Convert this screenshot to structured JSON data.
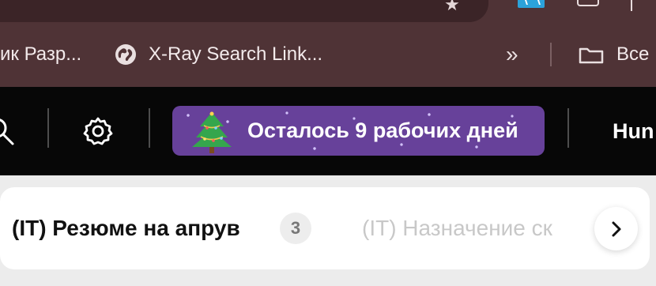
{
  "browser": {
    "bookmarks": [
      {
        "label": "ик Разр..."
      },
      {
        "label": "X-Ray Search Link..."
      },
      {
        "label": "Все"
      }
    ],
    "icons": {
      "star": "star-icon",
      "extension": "extension-icon",
      "window": "window-icon",
      "globe": "globe-icon",
      "overflow": "chevrons-right-icon",
      "folder": "folder-icon"
    },
    "glyphs": {
      "star": "★",
      "chevrons": "»"
    }
  },
  "app": {
    "banner_text": "Осталось 9 рабочих дней",
    "user_name": "Hun"
  },
  "tabs": {
    "active_label": "(IT) Резюме на апрув",
    "active_count": "3",
    "next_label": "(IT) Назначение ск"
  },
  "colors": {
    "browser_bg": "#4f3336",
    "app_bar_bg": "#070707",
    "banner_bg": "#67419a",
    "page_bg": "#ececec"
  }
}
